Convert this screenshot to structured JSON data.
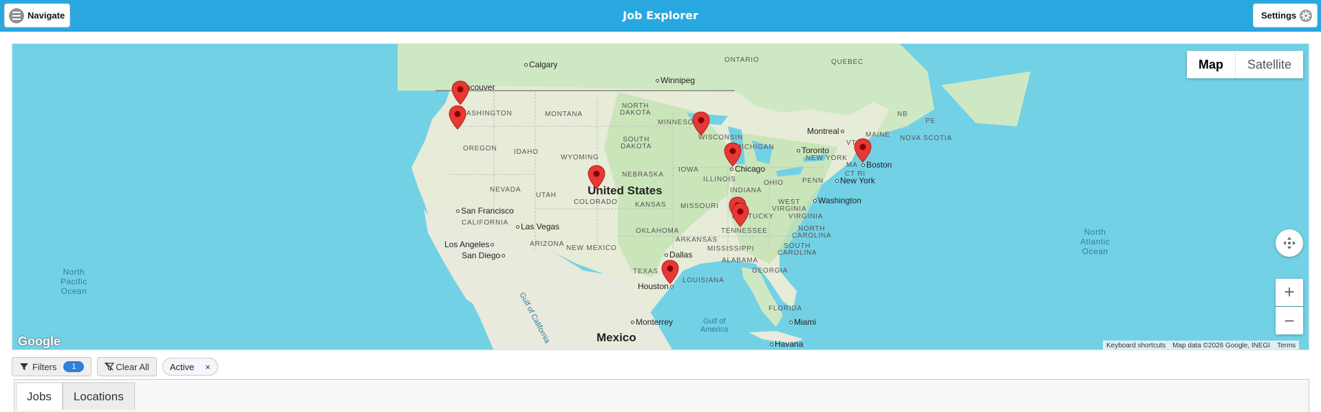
{
  "header": {
    "title": "Job Explorer",
    "navigate_label": "Navigate",
    "settings_label": "Settings",
    "colors": {
      "bar": "#29a8e0"
    }
  },
  "map": {
    "type_control": {
      "map_label": "Map",
      "satellite_label": "Satellite",
      "selected": "Map"
    },
    "labels": {
      "calgary": "Calgary",
      "winnipeg": "Winnipeg",
      "vancouver": "Vancouver",
      "washington_state": "WASHINGTON",
      "montana": "MONTANA",
      "north_dakota": "NORTH\nDAKOTA",
      "minnesota": "MINNESOTA",
      "ontario": "ONTARIO",
      "quebec": "QUEBEC",
      "nb": "NB",
      "pe": "PE",
      "nova_scotia": "NOVA SCOTIA",
      "maine": "MAINE",
      "vt": "VT",
      "montreal": "Montreal",
      "toronto": "Toronto",
      "oregon": "OREGON",
      "idaho": "IDAHO",
      "south_dakota": "SOUTH\nDAKOTA",
      "wisconsin": "WISCONSIN",
      "michigan": "MICHIGAN",
      "new_york_state": "NEW YORK",
      "ma": "MA",
      "ct_ri": "CT RI",
      "boston": "Boston",
      "wyoming": "WYOMING",
      "iowa": "IOWA",
      "chicago": "Chicago",
      "nebraska": "NEBRASKA",
      "illinois": "ILLINOIS",
      "ohio": "OHIO",
      "penn": "PENN",
      "new_york_city": "New York",
      "nevada": "NEVADA",
      "utah": "UTAH",
      "united_states": "United States",
      "colorado": "COLORADO",
      "indiana": "INDIANA",
      "kansas": "KANSAS",
      "missouri": "MISSOURI",
      "west_virginia": "WEST\nVIRGINIA",
      "washington_dc": "Washington",
      "san_francisco": "San Francisco",
      "california": "CALIFORNIA",
      "kentucky": "KENTUCKY",
      "virginia": "VIRGINIA",
      "las_vegas": "Las Vegas",
      "tennessee": "TENNESSEE",
      "north_carolina": "NORTH\nCAROLINA",
      "oklahoma": "OKLAHOMA",
      "arizona": "ARIZONA",
      "arkansas": "ARKANSAS",
      "los_angeles": "Los Angeles",
      "new_mexico": "NEW MEXICO",
      "mississippi": "MISSISSIPPI",
      "south_carolina": "SOUTH\nCAROLINA",
      "san_diego": "San Diego",
      "dallas": "Dallas",
      "alabama": "ALABAMA",
      "georgia": "GEORGIA",
      "texas": "TEXAS",
      "louisiana": "LOUISIANA",
      "houston": "Houston",
      "florida": "FLORIDA",
      "monterrey": "Monterrey",
      "miami": "Miami",
      "mexico": "Mexico",
      "havana": "Havana",
      "gulf_of_california": "Gulf of California",
      "gulf_of_america": "Gulf of\nAmerica",
      "north_pacific": "North\nPacific\nOcean",
      "north_atlantic": "North\nAtlantic\nOcean"
    },
    "attribution": {
      "keyboard": "Keyboard shortcuts",
      "data": "Map data ©2026 Google, INEGI",
      "terms": "Terms"
    },
    "google_logo": "Google",
    "colors": {
      "water": "#73d1e6",
      "land": "#cfe8c4",
      "pin": "#e53935"
    },
    "pin_icon": "map-marker",
    "pin_count": 11
  },
  "filters": {
    "filters_label": "Filters",
    "filters_count": "1",
    "clear_all_label": "Clear All",
    "active_chip": "Active",
    "chip_close": "×"
  },
  "tabs": [
    {
      "label": "Jobs",
      "active": true
    },
    {
      "label": "Locations",
      "active": false
    }
  ]
}
